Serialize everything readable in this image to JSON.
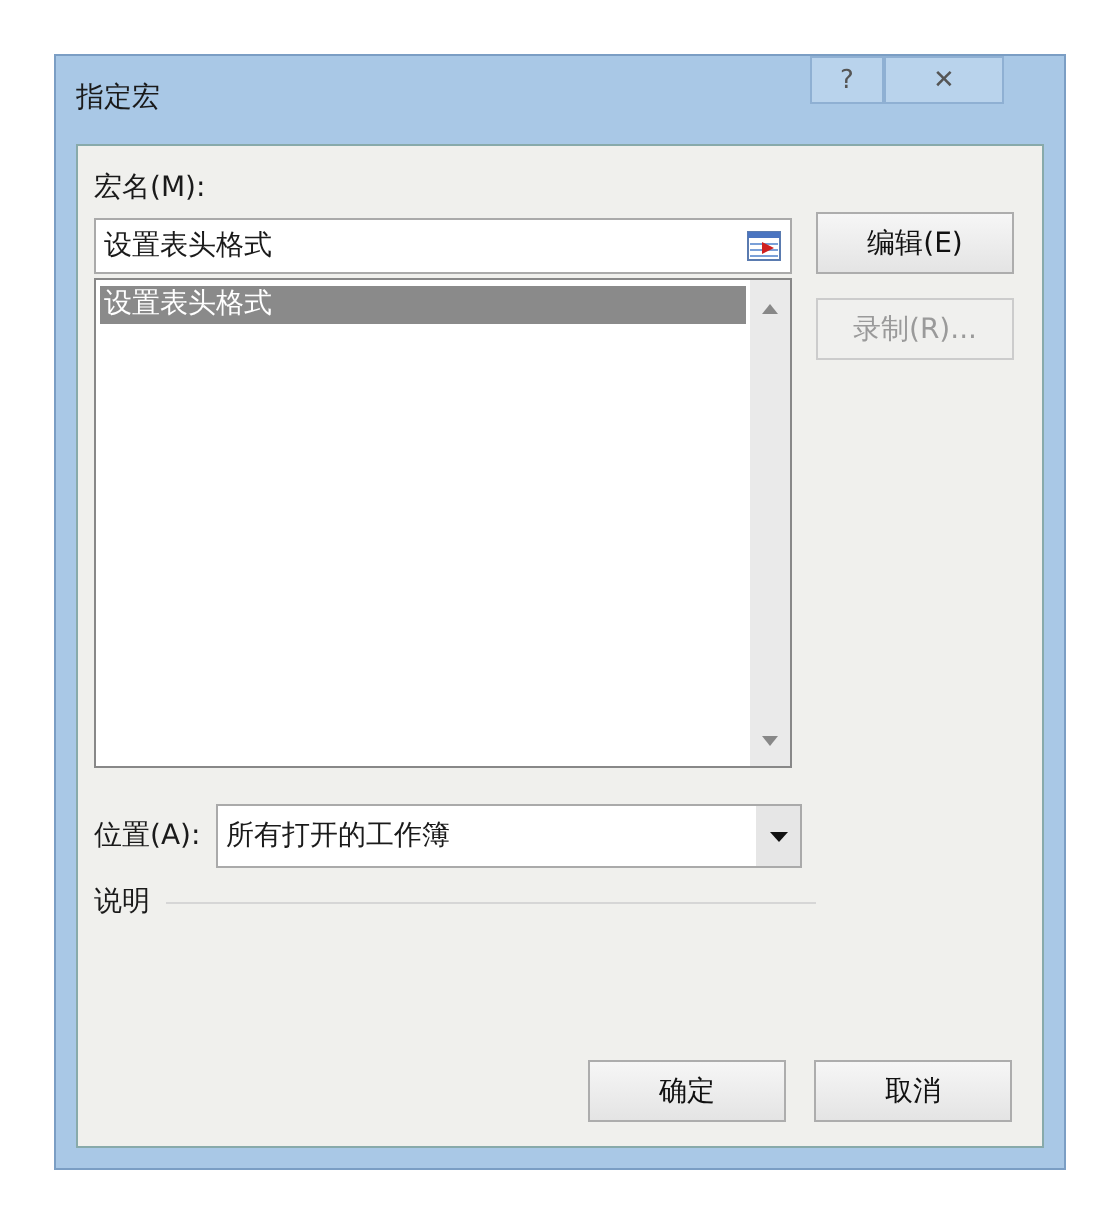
{
  "window": {
    "title": "指定宏"
  },
  "title_buttons": [
    {
      "kind": "help",
      "label": "?"
    },
    {
      "kind": "close",
      "label": "✕"
    }
  ],
  "macro_name": {
    "label": "宏名(M):",
    "value": "设置表头格式"
  },
  "macro_list": [
    {
      "label": "设置表头格式",
      "selected": true
    }
  ],
  "side_buttons": [
    {
      "label": "编辑(E)",
      "disabled": false
    },
    {
      "label": "录制(R)...",
      "disabled": true
    }
  ],
  "location": {
    "label": "位置(A):",
    "value": "所有打开的工作簿"
  },
  "description": {
    "label": "说明"
  },
  "buttons": [
    {
      "label": "确定"
    },
    {
      "label": "取消"
    }
  ]
}
